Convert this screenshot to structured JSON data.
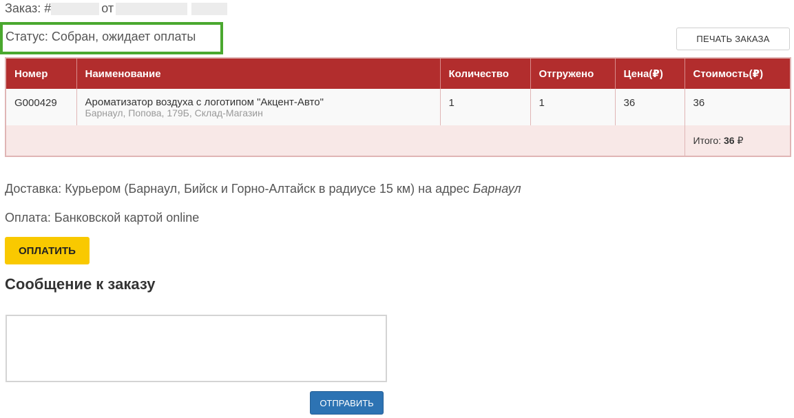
{
  "order": {
    "prefix": "Заказ: #",
    "date_prefix": "от"
  },
  "status": "Статус: Собран, ожидает оплаты",
  "print_button": "ПЕЧАТЬ ЗАКАЗА",
  "table": {
    "headers": [
      "Номер",
      "Наименование",
      "Количество",
      "Отгружено",
      "Цена(₽)",
      "Стоимость(₽)"
    ],
    "rows": [
      {
        "number": "G000429",
        "name": "Ароматизатор воздуха с логотипом \"Акцент-Авто\"",
        "location": "Барнаул, Попова, 179Б, Склад-Магазин",
        "quantity": "1",
        "shipped": "1",
        "price": "36",
        "cost": "36"
      }
    ],
    "total_label": "Итого:",
    "total_value": "36",
    "total_currency": "₽"
  },
  "delivery": {
    "text": "Доставка: Курьером (Барнаул, Бийск и Горно-Алтайск в радиусе 15 км) на адрес ",
    "address": "Барнаул"
  },
  "payment": "Оплата: Банковской картой online",
  "pay_button": "ОПЛАТИТЬ",
  "message": {
    "title": "Сообщение к заказу",
    "placeholder": "",
    "send_button": "ОТПРАВИТЬ"
  },
  "colors": {
    "header_bg": "#b22d2d",
    "status_border": "#4aa82f",
    "pay_button": "#f9c900",
    "send_button": "#2d73b3"
  }
}
